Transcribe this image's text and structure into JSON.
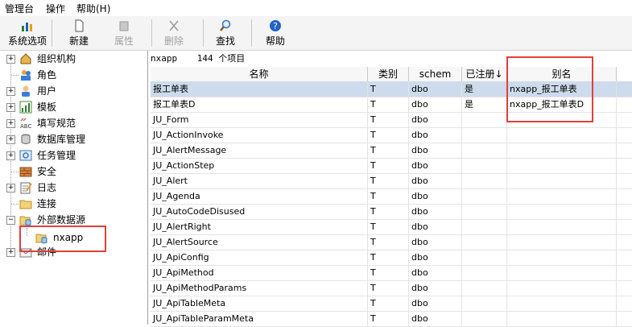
{
  "menu": [
    "管理台",
    "操作",
    "帮助(H)"
  ],
  "toolbar": {
    "system_options": "系统选项",
    "new": "新建",
    "properties": "属性",
    "delete": "删除",
    "find": "查找",
    "help": "帮助"
  },
  "tree": {
    "org": "组织机构",
    "role": "角色",
    "user": "用户",
    "template": "模板",
    "spec": "填写规范",
    "db": "数据库管理",
    "task": "任务管理",
    "security": "安全",
    "log": "日志",
    "connect": "连接",
    "external": "外部数据源",
    "nxapp": "nxapp",
    "mail": "邮件"
  },
  "info": {
    "source": "nxapp",
    "count": "144 个项目"
  },
  "columns": {
    "name": "名称",
    "type": "类别",
    "schema": "schem",
    "registered": "已注册↓",
    "alias": "别名"
  },
  "rows": [
    {
      "name": "报工单表",
      "type": "T",
      "schema": "dbo",
      "registered": "是",
      "alias": "nxapp_报工单表"
    },
    {
      "name": "报工单表D",
      "type": "T",
      "schema": "dbo",
      "registered": "是",
      "alias": "nxapp_报工单表D"
    },
    {
      "name": "JU_Form",
      "type": "T",
      "schema": "dbo",
      "registered": "",
      "alias": ""
    },
    {
      "name": "JU_ActionInvoke",
      "type": "T",
      "schema": "dbo",
      "registered": "",
      "alias": ""
    },
    {
      "name": "JU_AlertMessage",
      "type": "T",
      "schema": "dbo",
      "registered": "",
      "alias": ""
    },
    {
      "name": "JU_ActionStep",
      "type": "T",
      "schema": "dbo",
      "registered": "",
      "alias": ""
    },
    {
      "name": "JU_Alert",
      "type": "T",
      "schema": "dbo",
      "registered": "",
      "alias": ""
    },
    {
      "name": "JU_Agenda",
      "type": "T",
      "schema": "dbo",
      "registered": "",
      "alias": ""
    },
    {
      "name": "JU_AutoCodeDisused",
      "type": "T",
      "schema": "dbo",
      "registered": "",
      "alias": ""
    },
    {
      "name": "JU_AlertRight",
      "type": "T",
      "schema": "dbo",
      "registered": "",
      "alias": ""
    },
    {
      "name": "JU_AlertSource",
      "type": "T",
      "schema": "dbo",
      "registered": "",
      "alias": ""
    },
    {
      "name": "JU_ApiConfig",
      "type": "T",
      "schema": "dbo",
      "registered": "",
      "alias": ""
    },
    {
      "name": "JU_ApiMethod",
      "type": "T",
      "schema": "dbo",
      "registered": "",
      "alias": ""
    },
    {
      "name": "JU_ApiMethodParams",
      "type": "T",
      "schema": "dbo",
      "registered": "",
      "alias": ""
    },
    {
      "name": "JU_ApiTableMeta",
      "type": "T",
      "schema": "dbo",
      "registered": "",
      "alias": ""
    },
    {
      "name": "JU_ApiTableParamMeta",
      "type": "T",
      "schema": "dbo",
      "registered": "",
      "alias": ""
    }
  ]
}
